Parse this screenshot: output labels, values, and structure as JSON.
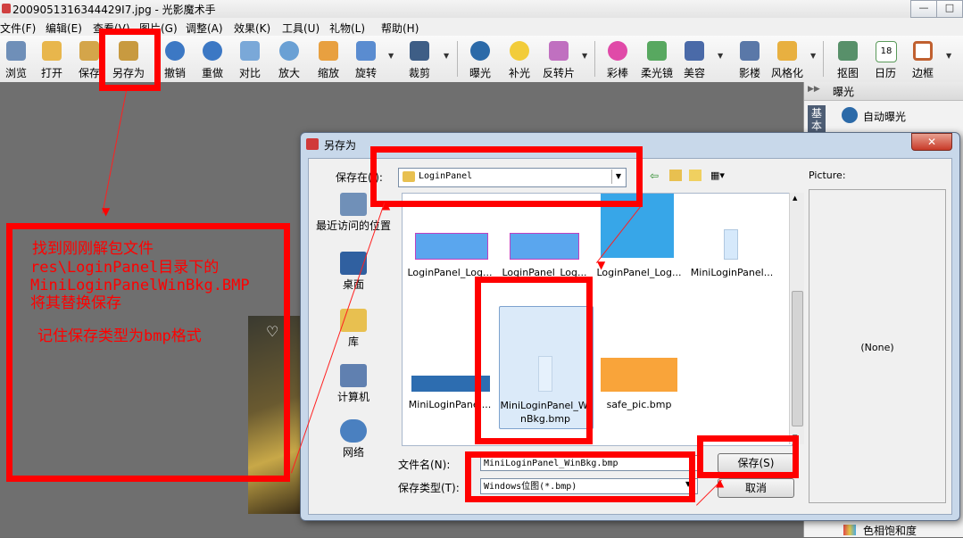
{
  "window": {
    "title": "2009051316344429I7.jpg - 光影魔术手",
    "min_label": "—",
    "max_label": "□"
  },
  "menu": [
    {
      "label": "文件(F)"
    },
    {
      "label": "编辑(E)"
    },
    {
      "label": "查看(V)"
    },
    {
      "label": "图片(G)"
    },
    {
      "label": "调整(A)"
    },
    {
      "label": "效果(K)"
    },
    {
      "label": "工具(U)"
    },
    {
      "label": "礼物(L)"
    },
    {
      "label": "帮助(H)"
    }
  ],
  "toolbar": [
    {
      "label": "浏览"
    },
    {
      "label": "打开"
    },
    {
      "label": "保存"
    },
    {
      "label": "另存为"
    },
    {
      "label": "撤销"
    },
    {
      "label": "重做"
    },
    {
      "label": "对比"
    },
    {
      "label": "放大"
    },
    {
      "label": "缩放"
    },
    {
      "label": "旋转"
    },
    {
      "label": "裁剪"
    },
    {
      "label": "曝光"
    },
    {
      "label": "补光"
    },
    {
      "label": "反转片"
    },
    {
      "label": "彩棒"
    },
    {
      "label": "柔光镜"
    },
    {
      "label": "美容"
    },
    {
      "label": "影楼"
    },
    {
      "label": "风格化"
    },
    {
      "label": "抠图"
    },
    {
      "label": "日历"
    },
    {
      "label": "边框"
    }
  ],
  "calendar_day": "18",
  "right_panel": {
    "header": "曝光",
    "tab": "基本",
    "item_top": "自动曝光",
    "item_bottom": "色相饱和度"
  },
  "dialog": {
    "title": "另存为",
    "close_label": "✕",
    "save_in_label": "保存在(I):",
    "folder": "LoginPanel",
    "places": [
      {
        "label": "最近访问的位置"
      },
      {
        "label": "桌面"
      },
      {
        "label": "库"
      },
      {
        "label": "计算机"
      },
      {
        "label": "网络"
      }
    ],
    "files": [
      {
        "name": "LoginPanel_Log...",
        "color": "#5aa6ee"
      },
      {
        "name": "LoginPanel_Log...",
        "color": "#5aa6ee"
      },
      {
        "name": "LoginPanel_Log...",
        "color": "#37a6e8"
      },
      {
        "name": "MiniLoginPanel...",
        "color": "#d6e9fb"
      },
      {
        "name": "MiniLoginPanel...",
        "color": "#2d6db0"
      },
      {
        "name": "MiniLoginPanel_WinBkg.bmp",
        "color": "#e6f1fc"
      },
      {
        "name": "safe_pic.bmp",
        "color": "#f9a43a"
      }
    ],
    "filename_label": "文件名(N):",
    "filename_value": "MiniLoginPanel_WinBkg.bmp",
    "filetype_label": "保存类型(T):",
    "filetype_value": "Windows位图(*.bmp)",
    "save_button": "保存(S)",
    "cancel_button": "取消",
    "preview_label": "Picture:",
    "preview_none": "(None)"
  },
  "annotation": {
    "line1": "找到刚刚解包文件",
    "line2": "res\\LoginPanel目录下的",
    "line3": "MiniLoginPanelWinBkg.BMP",
    "line4": "将其替换保存",
    "line5": "记住保存类型为bmp格式"
  }
}
